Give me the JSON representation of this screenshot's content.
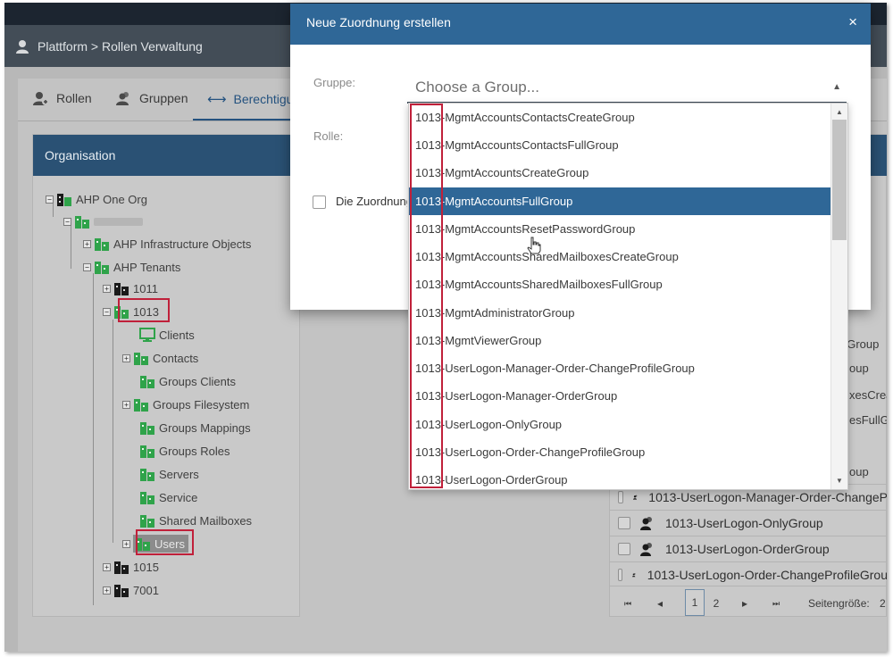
{
  "header": {
    "title": "Plattform > Rollen Verwaltung"
  },
  "tabs": [
    {
      "label": "Rollen",
      "icon": "role-add-icon",
      "active": false
    },
    {
      "label": "Gruppen",
      "icon": "group-icon",
      "active": false
    },
    {
      "label": "Berechtigungen",
      "icon": "arrows-horizontal-icon",
      "active": true
    }
  ],
  "organisation": {
    "header": "Organisation",
    "tree": [
      {
        "label": "AHP One Org"
      },
      {
        "label": ""
      },
      {
        "label": "AHP Infrastructure Objects"
      },
      {
        "label": "AHP Tenants"
      },
      {
        "label": "1011"
      },
      {
        "label": "1013"
      },
      {
        "label": "Clients"
      },
      {
        "label": "Contacts"
      },
      {
        "label": "Groups Clients"
      },
      {
        "label": "Groups Filesystem"
      },
      {
        "label": "Groups Mappings"
      },
      {
        "label": "Groups Roles"
      },
      {
        "label": "Servers"
      },
      {
        "label": "Service"
      },
      {
        "label": "Shared Mailboxes"
      },
      {
        "label": "Users"
      },
      {
        "label": "1015"
      },
      {
        "label": "7001"
      }
    ]
  },
  "right_panel": {
    "fragments": [
      "oup",
      "eGroup",
      "oup",
      "xesCrea",
      "esFullG",
      "oup"
    ],
    "rows": [
      "1013-UserLogon-Manager-Order-ChangeP",
      "1013-UserLogon-OnlyGroup",
      "1013-UserLogon-OrderGroup",
      "1013-UserLogon-Order-ChangeProfileGrou"
    ],
    "pager": {
      "first": "⏮",
      "prev": "◂",
      "pages": [
        "1",
        "2"
      ],
      "current": "1",
      "next": "▸",
      "last": "⏭",
      "page_size_label": "Seitengröße:",
      "page_size_value": "2"
    }
  },
  "modal": {
    "title": "Neue Zuordnung erstellen",
    "close": "×",
    "gruppe_label": "Gruppe:",
    "rolle_label": "Rolle:",
    "group_placeholder": "Choose a Group...",
    "checkbox_label": "Die Zuordnung",
    "dropdown": {
      "selected_index": 3,
      "items": [
        "1013-MgmtAccountsContactsCreateGroup",
        "1013-MgmtAccountsContactsFullGroup",
        "1013-MgmtAccountsCreateGroup",
        "1013-MgmtAccountsFullGroup",
        "1013-MgmtAccountsResetPasswordGroup",
        "1013-MgmtAccountsSharedMailboxesCreateGroup",
        "1013-MgmtAccountsSharedMailboxesFullGroup",
        "1013-MgmtAdministratorGroup",
        "1013-MgmtViewerGroup",
        "1013-UserLogon-Manager-Order-ChangeProfileGroup",
        "1013-UserLogon-Manager-OrderGroup",
        "1013-UserLogon-OnlyGroup",
        "1013-UserLogon-Order-ChangeProfileGroup",
        "1013-UserLogon-OrderGroup"
      ]
    }
  },
  "colors": {
    "modal_header": "#2f6797",
    "selected_item": "#2f6797",
    "highlight_box": "#c0203a",
    "building_green": "#2fa34a",
    "building_black": "#1a1a1a"
  }
}
